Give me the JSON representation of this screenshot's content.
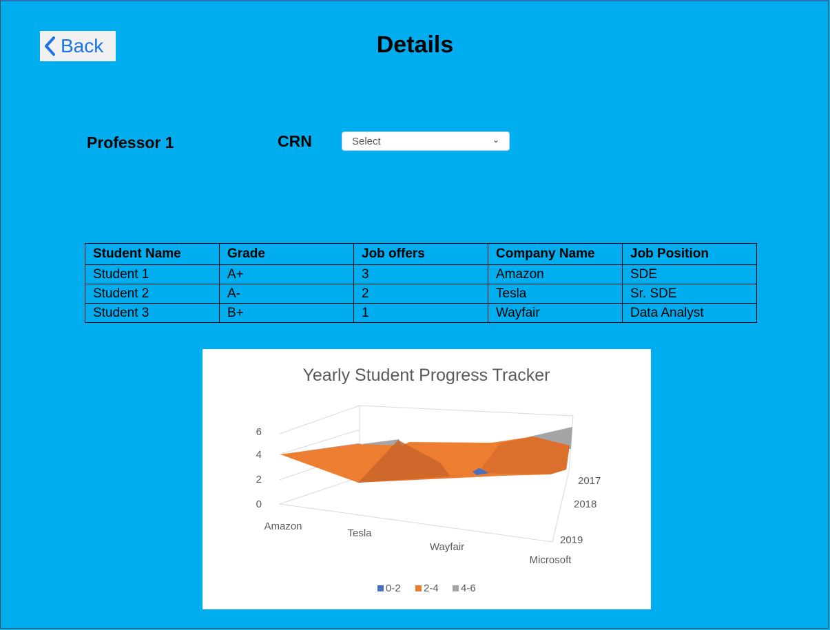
{
  "header": {
    "back_label": "Back",
    "title": "Details"
  },
  "filters": {
    "professor": "Professor 1",
    "crn_label": "CRN",
    "crn_select_value": "Select"
  },
  "table": {
    "columns": [
      "Student Name",
      "Grade",
      "Job offers",
      "Company Name",
      "Job Position"
    ],
    "rows": [
      [
        "Student 1",
        "A+",
        "3",
        "Amazon",
        "SDE"
      ],
      [
        "Student 2",
        "A-",
        "2",
        "Tesla",
        "Sr. SDE"
      ],
      [
        "Student 3",
        "B+",
        "1",
        "Wayfair",
        "Data Analyst"
      ]
    ]
  },
  "colors": {
    "background": "#00AEEF",
    "band_0_2": "#4472C4",
    "band_2_4": "#ED7D31",
    "band_4_6": "#A5A5A5"
  },
  "chart_data": {
    "type": "surface",
    "title": "Yearly Student Progress Tracker",
    "categories": [
      "Amazon",
      "Tesla",
      "Wayfair",
      "Microsoft"
    ],
    "series_axis": [
      "2017",
      "2018",
      "2019"
    ],
    "z_ticks": [
      0,
      2,
      4,
      6
    ],
    "zlim": [
      0,
      6
    ],
    "legend": [
      {
        "label": "0-2",
        "color": "#4472C4"
      },
      {
        "label": "2-4",
        "color": "#ED7D31"
      },
      {
        "label": "4-6",
        "color": "#A5A5A5"
      }
    ],
    "legend_position": "bottom",
    "grid": true
  }
}
